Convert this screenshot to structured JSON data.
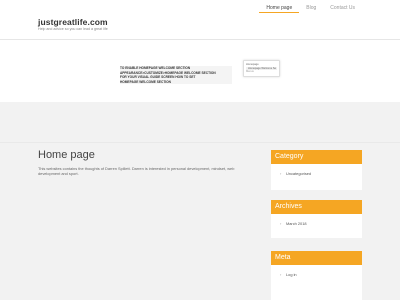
{
  "site": {
    "title": "justgreatlife.com",
    "tagline": "Help and advice so you can lead a great life"
  },
  "nav": [
    {
      "label": "Home page"
    },
    {
      "label": "Blog"
    },
    {
      "label": "Contact Us"
    }
  ],
  "hero": {
    "lines": [
      "TO ENABLE HOMEPAGE WELCOME SECTION",
      "APPEARANCE>CUSTOMIZE>HOMEPAGE WELCOME SECTION",
      "FOR YOUR VISUAL GUIDE SCREEN HOW TO SET",
      "HOMEPAGE WELCOME SECTION"
    ],
    "popup": {
      "line1": "Homepage",
      "line2": "Homepage Welcome Se",
      "line3": "Menus"
    }
  },
  "main": {
    "heading": "Home page",
    "text": "This websites contains the thoughts of Darren Spillett. Darren is interested in personal development, mindset, web development and sport."
  },
  "sidebar": {
    "category": {
      "title": "Category",
      "items": [
        "Uncategorised"
      ]
    },
    "archives": {
      "title": "Archives",
      "items": [
        "March 2018"
      ]
    },
    "meta": {
      "title": "Meta",
      "items": [
        "Log in"
      ]
    }
  },
  "colors": {
    "accent": "#f5a623",
    "background": "#f2f2f2",
    "heading": "#444444"
  }
}
